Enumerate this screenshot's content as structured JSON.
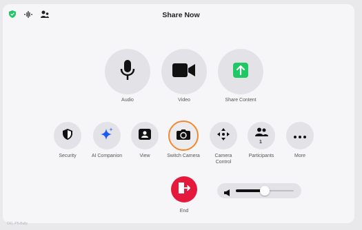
{
  "header": {
    "title": "Share Now",
    "status_icons": [
      "shield-check-icon",
      "audio-wave-icon",
      "people-icon"
    ]
  },
  "primary_actions": [
    {
      "label": "Audio",
      "icon": "microphone-icon"
    },
    {
      "label": "Video",
      "icon": "video-camera-icon"
    },
    {
      "label": "Share Content",
      "icon": "share-up-arrow-icon",
      "accent": "#1fc765"
    }
  ],
  "secondary_actions": [
    {
      "label": "Security",
      "icon": "shield-icon"
    },
    {
      "label": "AI Companion",
      "icon": "sparkle-icon",
      "accent": "#1b5cf2"
    },
    {
      "label": "View",
      "icon": "person-card-icon"
    },
    {
      "label": "Switch Camera",
      "icon": "switch-camera-icon",
      "selected": true,
      "accent": "#f0892f"
    },
    {
      "label": "Camera\nControl",
      "icon": "directional-arrows-icon"
    },
    {
      "label": "Participants",
      "icon": "participants-icon",
      "badge": "1"
    },
    {
      "label": "More",
      "icon": "ellipsis-icon"
    }
  ],
  "end": {
    "label": "End",
    "icon": "exit-door-icon",
    "color": "#e5193c"
  },
  "volume": {
    "level": 0.5,
    "icon": "speaker-icon"
  },
  "footer_text": "DEL-P5-Bully"
}
